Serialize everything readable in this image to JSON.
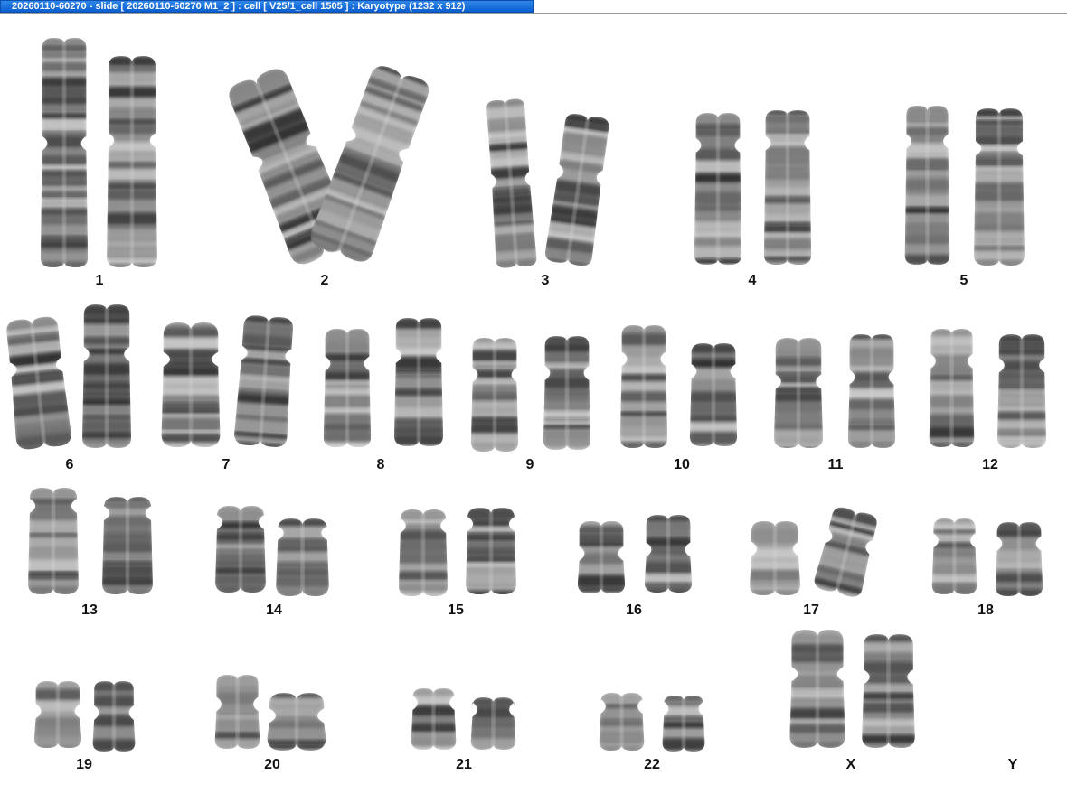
{
  "window": {
    "title": "20260110-60270 - slide [ 20260110-60270 M1_2 ] : cell [ V25/1_cell 1505 ] : Karyotype  (1232 x 912)"
  },
  "karyotype": {
    "labels": [
      "1",
      "2",
      "3",
      "4",
      "5",
      "6",
      "7",
      "8",
      "9",
      "10",
      "11",
      "12",
      "13",
      "14",
      "15",
      "16",
      "17",
      "18",
      "19",
      "20",
      "21",
      "22",
      "X",
      "Y"
    ]
  }
}
